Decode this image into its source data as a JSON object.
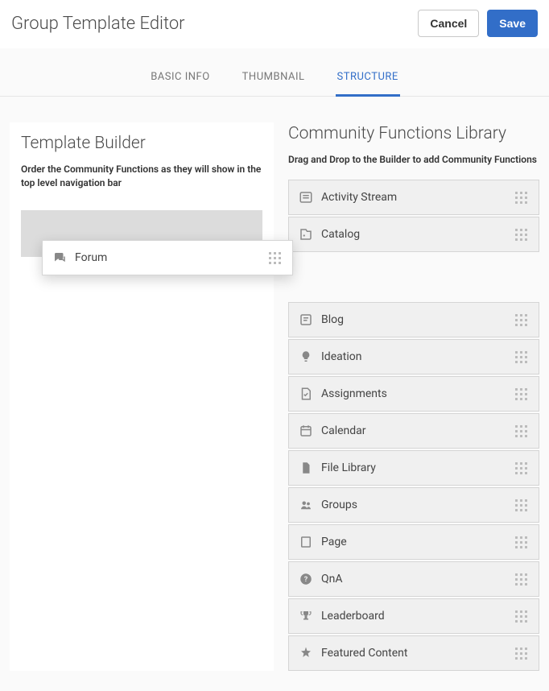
{
  "header": {
    "title": "Group Template Editor",
    "cancel": "Cancel",
    "save": "Save"
  },
  "tabs": {
    "basic": "BASIC INFO",
    "thumbnail": "THUMBNAIL",
    "structure": "STRUCTURE"
  },
  "builder": {
    "title": "Template Builder",
    "sub": "Order the Community Functions as they will show in the top level navigation bar",
    "dragging": "Forum"
  },
  "library": {
    "title": "Community Functions Library",
    "sub": "Drag and Drop to the Builder to add Community Functions",
    "items": [
      {
        "label": "Activity Stream",
        "icon": "list"
      },
      {
        "label": "Catalog",
        "icon": "catalog"
      },
      {
        "label": "Blog",
        "icon": "blog"
      },
      {
        "label": "Ideation",
        "icon": "idea"
      },
      {
        "label": "Assignments",
        "icon": "assign"
      },
      {
        "label": "Calendar",
        "icon": "calendar"
      },
      {
        "label": "File Library",
        "icon": "file"
      },
      {
        "label": "Groups",
        "icon": "groups"
      },
      {
        "label": "Page",
        "icon": "page"
      },
      {
        "label": "QnA",
        "icon": "qna"
      },
      {
        "label": "Leaderboard",
        "icon": "trophy"
      },
      {
        "label": "Featured Content",
        "icon": "star"
      }
    ]
  }
}
